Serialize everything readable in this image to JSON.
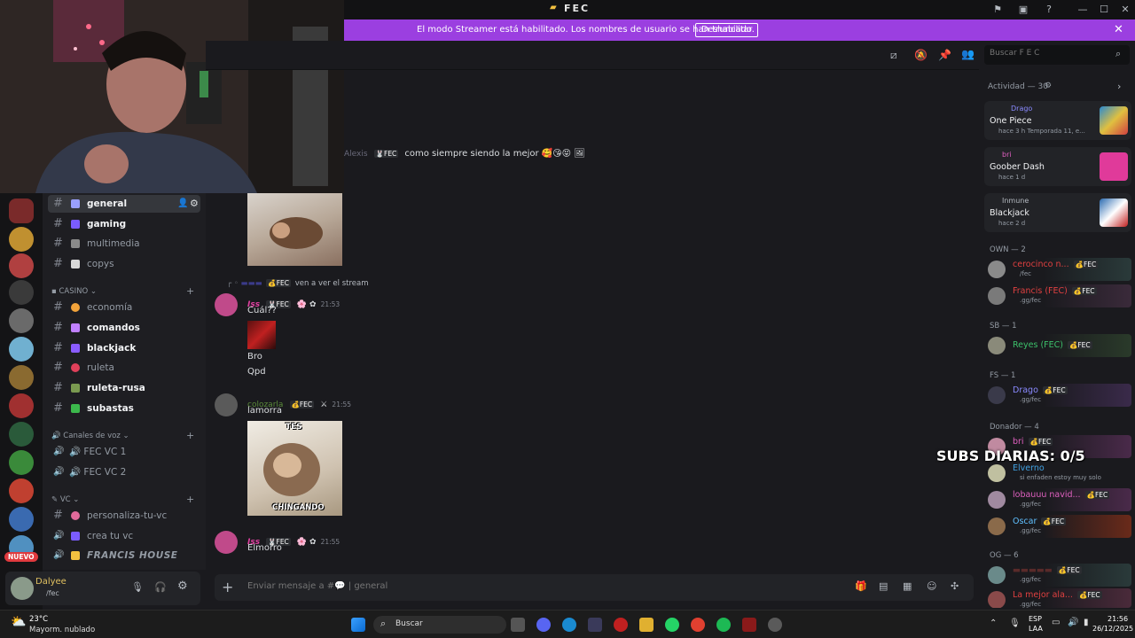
{
  "app": {
    "title": "FEC"
  },
  "window_controls": {
    "minimize": "—",
    "maximize": "☐",
    "close": "✕"
  },
  "banner": {
    "text": "El modo Streamer está habilitado. Los nombres de usuario se han truncado.",
    "button": "Deshabilitar",
    "close": "✕"
  },
  "channels": {
    "top": [
      {
        "name": "general",
        "active": true,
        "color": "#9aa0ff"
      },
      {
        "name": "gaming",
        "bold": true,
        "color": "#7a5cff"
      },
      {
        "name": "multimedia",
        "color": "#8a8a8a"
      },
      {
        "name": "copys",
        "color": "#d9d9d9"
      }
    ],
    "casino_label": "CASINO",
    "casino": [
      {
        "name": "economía",
        "color": "#f2a33a"
      },
      {
        "name": "comandos",
        "bold": true,
        "color": "#c080ff"
      },
      {
        "name": "blackjack",
        "bold": true,
        "color": "#8a5cff"
      },
      {
        "name": "ruleta",
        "color": "#e0405a"
      },
      {
        "name": "ruleta-rusa",
        "bold": true,
        "color": "#7a9a50"
      },
      {
        "name": "subastas",
        "bold": true,
        "color": "#3cb84c"
      }
    ],
    "voice_label": "Canales de voz",
    "voice": [
      {
        "name": "FEC VC 1"
      },
      {
        "name": "FEC VC 2"
      }
    ],
    "vc_label": "VC",
    "vc": [
      {
        "name": "personaliza-tu-vc",
        "color": "#e06a9a"
      },
      {
        "name": "crea tu vc",
        "color": "#7a5cff"
      },
      {
        "name": "FRANCIS HOUSE",
        "color": "#f2c040"
      }
    ]
  },
  "server_badge": "NUEVO",
  "user": {
    "name": "Dalyee",
    "status": "/fec"
  },
  "messages": [
    {
      "author": "Alexis",
      "tag": "FEC",
      "text": "como siempre siendo la mejor 🥰😘😝 🖼"
    },
    {
      "reply_tag": "FEC",
      "reply_text": "ven a ver el stream",
      "author": "Iss",
      "tag": "FEC",
      "time": "21:53",
      "lines": [
        "Cuál??",
        "Bro",
        "Qpd"
      ]
    },
    {
      "author": "colozarla",
      "tag": "FEC",
      "time": "21:55",
      "text": "lamorra",
      "image_top": "TES",
      "image_bottom": "CHINGANDO"
    },
    {
      "author": "Iss",
      "tag": "FEC",
      "time": "21:55",
      "text": "Elmorro"
    }
  ],
  "composer": {
    "placeholder": "Enviar mensaje a #💬 | general"
  },
  "search": {
    "placeholder": "Buscar F E C"
  },
  "activity": {
    "header": "Actividad — 30",
    "cards": [
      {
        "user": "Drago",
        "game": "One Piece",
        "meta": "hace 3 h   Temporada 11, e..."
      },
      {
        "user": "bri",
        "game": "Goober Dash",
        "meta": "hace 1 d"
      },
      {
        "user": "Inmune",
        "game": "Blackjack",
        "meta": "hace 2 d"
      }
    ]
  },
  "member_groups": [
    {
      "label": "OWN — 2",
      "members": [
        {
          "name": "cerocinco n...",
          "tag": "FEC",
          "sub": "/fec",
          "color": "#e04040"
        },
        {
          "name": "Francis (FEC)",
          "tag": "FEC",
          "sub": ".gg/fec",
          "color": "#e04040"
        }
      ]
    },
    {
      "label": "SB — 1",
      "members": [
        {
          "name": "Reyes (FEC)",
          "tag": "FEC",
          "sub": "",
          "color": "#3cc06a"
        }
      ]
    },
    {
      "label": "FS — 1",
      "members": [
        {
          "name": "Drago",
          "tag": "FEC",
          "sub": ".gg/fec",
          "color": "#8a8aff"
        }
      ]
    },
    {
      "label": "Donador — 4",
      "members": [
        {
          "name": "bri",
          "tag": "FEC",
          "sub": "",
          "color": "#e060c0"
        },
        {
          "name": "Elverno",
          "tag": "",
          "sub": "si enfaden estoy muy solo",
          "color": "#40a0e0"
        },
        {
          "name": "lobauuu navid...",
          "tag": "FEC",
          "sub": ".gg/fec",
          "color": "#e060c0"
        },
        {
          "name": "Oscar",
          "tag": "FEC",
          "sub": ".gg/fec",
          "color": "#60c0ff"
        }
      ]
    },
    {
      "label": "OG — 6",
      "members": [
        {
          "name": "",
          "tag": "FEC",
          "sub": ".gg/fec",
          "color": "#e04040"
        },
        {
          "name": "La mejor ala...",
          "tag": "FEC",
          "sub": ".gg/fec",
          "color": "#e04040"
        }
      ]
    }
  ],
  "overlay": {
    "subs": "SUBS DIARIAS: 0/5"
  },
  "taskbar": {
    "weather_temp": "23°C",
    "weather_desc": "Mayorm. nublado",
    "search": "Buscar",
    "lang1": "ESP",
    "lang2": "LAA",
    "time": "21:56",
    "date": "26/12/2025"
  },
  "colors": {
    "accent": "#9b3fe0",
    "bg": "#1a1a1e",
    "sidebar": "#1e1e22"
  }
}
